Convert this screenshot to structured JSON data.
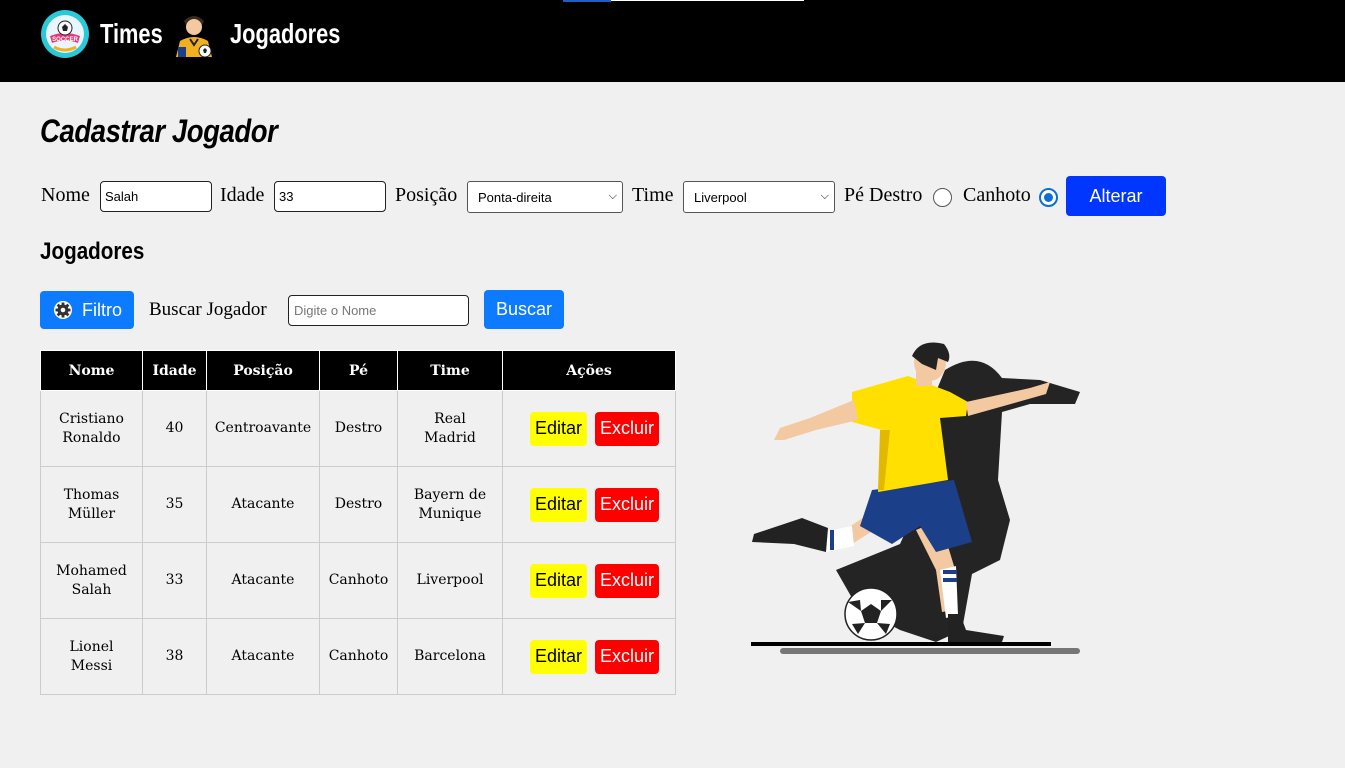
{
  "nav": {
    "times_label": "Times",
    "jogadores_label": "Jogadores"
  },
  "form": {
    "title": "Cadastrar Jogador",
    "nome_label": "Nome",
    "nome_value": "Salah",
    "idade_label": "Idade",
    "idade_value": "33",
    "posicao_label": "Posição",
    "posicao_value": "Ponta-direita",
    "time_label": "Time",
    "time_value": "Liverpool",
    "pe_destro_label": "Pé Destro",
    "pe_destro_checked": false,
    "canhoto_label": "Canhoto",
    "canhoto_checked": true,
    "submit_label": "Alterar"
  },
  "list": {
    "title": "Jogadores",
    "filter_label": "Filtro",
    "search_label": "Buscar Jogador",
    "search_placeholder": "Digite o Nome",
    "search_button": "Buscar"
  },
  "table": {
    "headers": [
      "Nome",
      "Idade",
      "Posição",
      "Pé",
      "Time",
      "Ações"
    ],
    "edit_label": "Editar",
    "delete_label": "Excluir",
    "rows": [
      {
        "nome1": "Cristiano",
        "nome2": "Ronaldo",
        "idade": "40",
        "posicao": "Centroavante",
        "pe": "Destro",
        "time1": "Real",
        "time2": "Madrid"
      },
      {
        "nome1": "Thomas",
        "nome2": "Müller",
        "idade": "35",
        "posicao": "Atacante",
        "pe": "Destro",
        "time1": "Bayern de",
        "time2": "Munique"
      },
      {
        "nome1": "Mohamed",
        "nome2": "Salah",
        "idade": "33",
        "posicao": "Atacante",
        "pe": "Canhoto",
        "time1": "Liverpool",
        "time2": ""
      },
      {
        "nome1": "Lionel",
        "nome2": "Messi",
        "idade": "38",
        "posicao": "Atacante",
        "pe": "Canhoto",
        "time1": "Barcelona",
        "time2": ""
      }
    ]
  },
  "colors": {
    "topbar": "#000000",
    "primary_button": "#0036ff",
    "secondary_button": "#0d7bff",
    "edit_button": "#ffff00",
    "delete_button": "#ff0000",
    "page_background": "#f0f0f0"
  },
  "icons": {
    "times_logo": "soccer-badge-icon",
    "jogadores_logo": "soccer-player-icon",
    "filter": "gear-icon",
    "illustration": "soccer-player-kicking-ball"
  }
}
